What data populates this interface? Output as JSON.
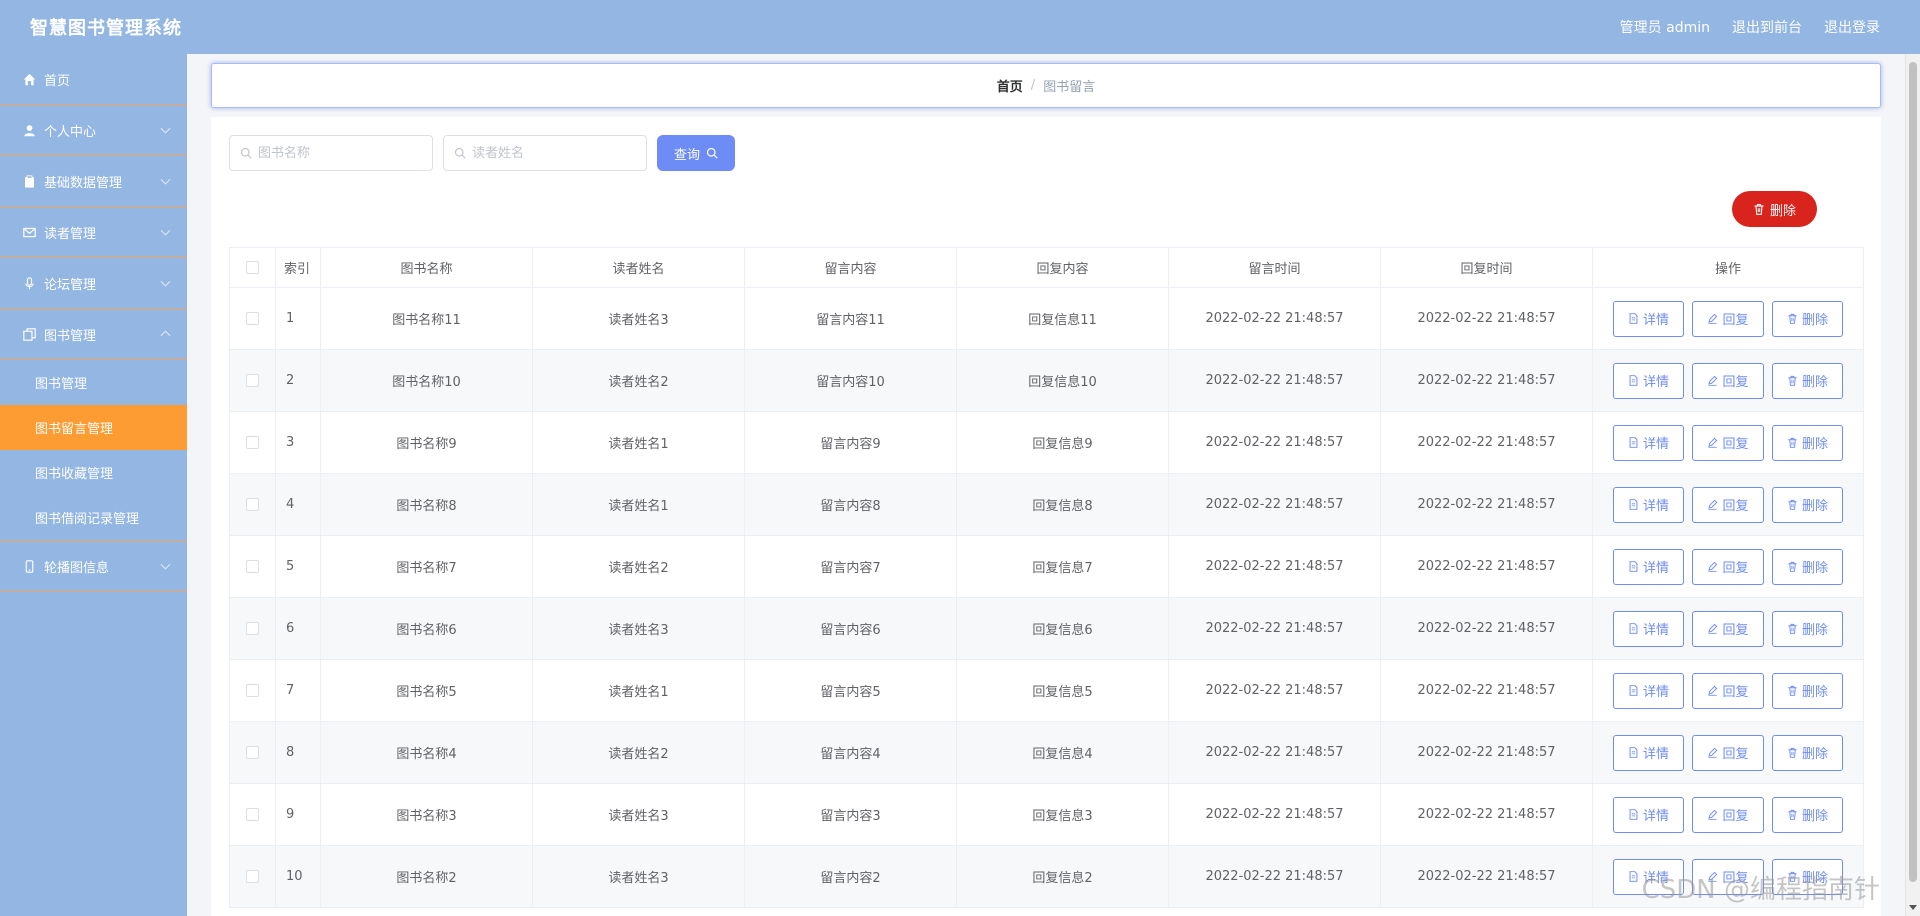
{
  "header": {
    "title": "智慧图书管理系统",
    "admin_label": "管理员 admin",
    "exit_front_label": "退出到前台",
    "logout_label": "退出登录"
  },
  "sidebar": {
    "items": [
      {
        "label": "首页",
        "icon": "home-icon"
      },
      {
        "label": "个人中心",
        "icon": "user-icon"
      },
      {
        "label": "基础数据管理",
        "icon": "clipboard-icon"
      },
      {
        "label": "读者管理",
        "icon": "mail-icon"
      },
      {
        "label": "论坛管理",
        "icon": "microphone-icon"
      },
      {
        "label": "图书管理",
        "icon": "copy-icon"
      },
      {
        "label": "轮播图信息",
        "icon": "mobile-icon"
      }
    ],
    "submenu": [
      "图书管理",
      "图书留言管理",
      "图书收藏管理",
      "图书借阅记录管理"
    ]
  },
  "breadcrumb": {
    "home": "首页",
    "separator": "/",
    "current": "图书留言"
  },
  "search": {
    "book_placeholder": "图书名称",
    "reader_placeholder": "读者姓名",
    "query_label": "查询"
  },
  "bulk_delete_label": "删除",
  "table": {
    "headers": [
      "索引",
      "图书名称",
      "读者姓名",
      "留言内容",
      "回复内容",
      "留言时间",
      "回复时间",
      "操作"
    ],
    "rows": [
      {
        "index": "1",
        "book": "图书名称11",
        "reader": "读者姓名3",
        "message": "留言内容11",
        "reply": "回复信息11",
        "msg_time": "2022-02-22 21:48:57",
        "reply_time": "2022-02-22 21:48:57"
      },
      {
        "index": "2",
        "book": "图书名称10",
        "reader": "读者姓名2",
        "message": "留言内容10",
        "reply": "回复信息10",
        "msg_time": "2022-02-22 21:48:57",
        "reply_time": "2022-02-22 21:48:57"
      },
      {
        "index": "3",
        "book": "图书名称9",
        "reader": "读者姓名1",
        "message": "留言内容9",
        "reply": "回复信息9",
        "msg_time": "2022-02-22 21:48:57",
        "reply_time": "2022-02-22 21:48:57"
      },
      {
        "index": "4",
        "book": "图书名称8",
        "reader": "读者姓名1",
        "message": "留言内容8",
        "reply": "回复信息8",
        "msg_time": "2022-02-22 21:48:57",
        "reply_time": "2022-02-22 21:48:57"
      },
      {
        "index": "5",
        "book": "图书名称7",
        "reader": "读者姓名2",
        "message": "留言内容7",
        "reply": "回复信息7",
        "msg_time": "2022-02-22 21:48:57",
        "reply_time": "2022-02-22 21:48:57"
      },
      {
        "index": "6",
        "book": "图书名称6",
        "reader": "读者姓名3",
        "message": "留言内容6",
        "reply": "回复信息6",
        "msg_time": "2022-02-22 21:48:57",
        "reply_time": "2022-02-22 21:48:57"
      },
      {
        "index": "7",
        "book": "图书名称5",
        "reader": "读者姓名1",
        "message": "留言内容5",
        "reply": "回复信息5",
        "msg_time": "2022-02-22 21:48:57",
        "reply_time": "2022-02-22 21:48:57"
      },
      {
        "index": "8",
        "book": "图书名称4",
        "reader": "读者姓名2",
        "message": "留言内容4",
        "reply": "回复信息4",
        "msg_time": "2022-02-22 21:48:57",
        "reply_time": "2022-02-22 21:48:57"
      },
      {
        "index": "9",
        "book": "图书名称3",
        "reader": "读者姓名3",
        "message": "留言内容3",
        "reply": "回复信息3",
        "msg_time": "2022-02-22 21:48:57",
        "reply_time": "2022-02-22 21:48:57"
      },
      {
        "index": "10",
        "book": "图书名称2",
        "reader": "读者姓名3",
        "message": "留言内容2",
        "reply": "回复信息2",
        "msg_time": "2022-02-22 21:48:57",
        "reply_time": "2022-02-22 21:48:57"
      }
    ],
    "actions": {
      "detail": "详情",
      "reply": "回复",
      "delete": "删除"
    }
  },
  "watermark": "CSDN @编程指南针",
  "colors": {
    "header_bg": "#93b6e2",
    "sidebar_bg": "#93b6e2",
    "active_menu": "#fc9c32",
    "primary": "#6d8cf6",
    "danger": "#d9231d"
  }
}
